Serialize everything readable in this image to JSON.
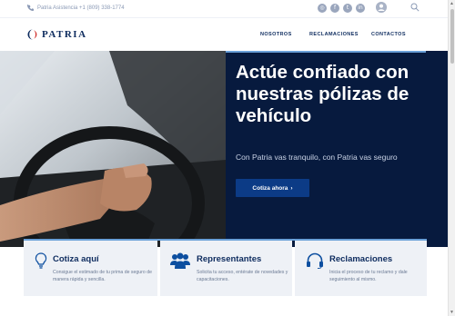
{
  "topbar": {
    "phone": "Patria Asistencia +1 (809) 338-1774",
    "social": [
      {
        "name": "instagram-icon",
        "glyph": "◎"
      },
      {
        "name": "facebook-icon",
        "glyph": "f"
      },
      {
        "name": "twitter-icon",
        "glyph": "t"
      },
      {
        "name": "linkedin-icon",
        "glyph": "in"
      }
    ]
  },
  "header": {
    "brand": "PATRIA",
    "nav": [
      "NOSOTROS",
      "RECLAMACIONES",
      "CONTACTOS"
    ]
  },
  "hero": {
    "title": "Actúe confiado con nuestras pólizas de vehículo",
    "subtitle": "Con Patria vas tranquilo, con Patria vas seguro",
    "cta": "Cotiza ahora",
    "cta_arrow": "›"
  },
  "cards": [
    {
      "title": "Cotiza aquí",
      "desc": "Consigue el estimado de tu prima de seguro de manera rápida y sencilla.",
      "icon": "lightbulb-icon"
    },
    {
      "title": "Representantes",
      "desc": "Solicita tu acceso, entérate de novedades y capacitaciones.",
      "icon": "group-icon"
    },
    {
      "title": "Reclamaciones",
      "desc": "Inicia el proceso de tu reclamo y dale seguimiento al mismo.",
      "icon": "headset-icon"
    }
  ],
  "colors": {
    "navy": "#071a3e",
    "brand_blue": "#0d2b5e",
    "button_blue": "#0c3b86",
    "accent_red": "#d0312d",
    "accent_line": "#6aa0d8",
    "card_bg": "#eef1f6"
  }
}
